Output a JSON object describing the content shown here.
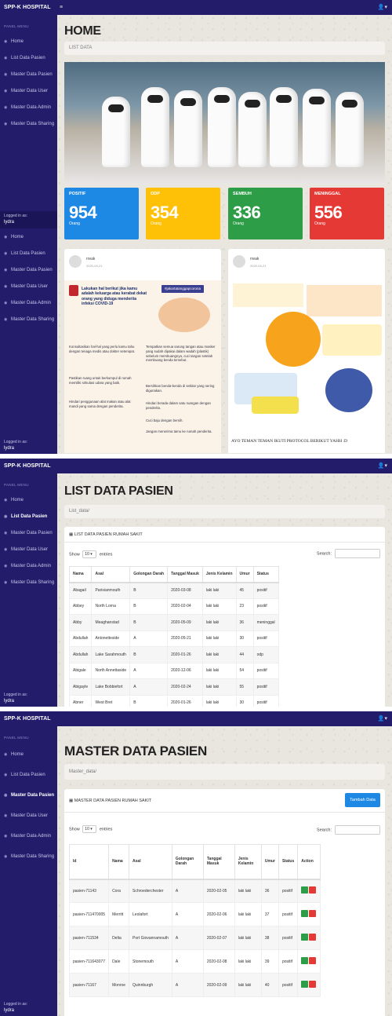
{
  "app": {
    "brand": "SPP-K HOSPITAL",
    "user_icon": "user-icon"
  },
  "sidebar": {
    "menu_header": "PANEL MENU",
    "items": [
      "Home",
      "List Data Pasien",
      "Master Data Pasien",
      "Master Data User",
      "Master Data Admin",
      "Master Data Sharing"
    ],
    "logged_label": "Logged in as:",
    "logged_user": "lydra"
  },
  "home": {
    "title": "HOME",
    "breadcrumb": "LIST DATA",
    "stats": [
      {
        "label": "POSITIF",
        "value": "954",
        "unit": "Orang",
        "color": "#1e88e5"
      },
      {
        "label": "ODP",
        "value": "354",
        "unit": "Orang",
        "color": "#ffc107"
      },
      {
        "label": "SEMBUH",
        "value": "336",
        "unit": "Orang",
        "color": "#2e9d48"
      },
      {
        "label": "MENINGGAL",
        "value": "556",
        "unit": "Orang",
        "color": "#e53935"
      }
    ],
    "posts": [
      {
        "name": "rreak",
        "date": "2020-04-21",
        "hashtag": "#jakartatanggapcorona",
        "intro": "Lakukan hal berikut jika kamu adalah keluarga atau kerabat dekat orang yang diduga menderita infeksi COVID-19",
        "steps": [
          "Konsultasikan hal-hal yang perlu kamu tahu dengan tenaga medis atau dokter setempat.",
          "Pastikan ruang untuk berkumpul di rumah memiliki sirkulasi udara yang baik.",
          "Hindari penggunaan alat makan atau alat mandi yang sama dengan penderita.",
          "Tempatkan semua sarung tangan atau masker yang sudah dipakai dalam wadah (plastik) sebelum membuangnya, cuci tangan setelah membuang benda tersebut.",
          "Bersihkan benda-benda di sekitar yang sering digunakan.",
          "Hindari berada dalam satu ruangan dengan penderita.",
          "Cuci baju dengan bersih.",
          "Jangan menerima tamu ke rumah penderita."
        ]
      },
      {
        "name": "rreak",
        "date": "2020-04-21",
        "caption": "AYO TEMAN TEMAN IKUTI PROTOCOL BERIKUT YAHH :D"
      }
    ]
  },
  "list": {
    "title": "LIST DATA PASIEN",
    "breadcrumb": "List_data/",
    "card_title": "LIST DATA PASIEN RUMAH SAKIT",
    "show": "Show",
    "entries": "entries",
    "entries_value": "10",
    "search": "Search:",
    "columns": [
      "Nama",
      "Asal",
      "Golongan Darah",
      "Tanggal Masuk",
      "Jenis Kelamin",
      "Umur",
      "Status"
    ],
    "rows": [
      [
        "Abagail",
        "Parisianmouth",
        "B",
        "2020-03-08",
        "laki laki",
        "45",
        "positif"
      ],
      [
        "Abbey",
        "North Lorna",
        "B",
        "2020-02-04",
        "laki laki",
        "23",
        "positif"
      ],
      [
        "Abby",
        "Meaghanstad",
        "B",
        "2020-05-09",
        "laki laki",
        "36",
        "meninggal"
      ],
      [
        "Abdullah",
        "Antonetteside",
        "A",
        "2020-05-21",
        "laki laki",
        "30",
        "positif"
      ],
      [
        "Abdullah",
        "Lake Sarahmouth",
        "B",
        "2020-01-26",
        "laki laki",
        "44",
        "odp"
      ],
      [
        "Abigale",
        "North Annettaside",
        "A",
        "2020-12-06",
        "laki laki",
        "54",
        "positif"
      ],
      [
        "Abigayle",
        "Lake Bobbiefort",
        "A",
        "2020-02-24",
        "laki laki",
        "55",
        "positif"
      ],
      [
        "Abner",
        "West Bret",
        "B",
        "2020-01-26",
        "laki laki",
        "30",
        "positif"
      ]
    ]
  },
  "master": {
    "title": "MASTER DATA PASIEN",
    "breadcrumb": "Master_data/",
    "card_title": "MASTER DATA PASIEN RUMAH SAKIT",
    "add_button": "Tambah Data",
    "show": "Show",
    "entries": "entries",
    "entries_value": "10",
    "search": "Search:",
    "columns": [
      "Id",
      "Nama",
      "Asal",
      "Golongan Darah",
      "Tanggal Masuk",
      "Jenis Kelamin",
      "Umur",
      "Status",
      "Action"
    ],
    "rows": [
      [
        "pasien-71143",
        "Cora",
        "Schroederchester",
        "A",
        "2020-02-05",
        "laki laki",
        "36",
        "positif"
      ],
      [
        "pasien-711470005",
        "Merritt",
        "Leolafort",
        "A",
        "2020-02-06",
        "laki laki",
        "37",
        "positif"
      ],
      [
        "pasien-711534",
        "Delta",
        "Port Giovannamouth",
        "A",
        "2020-02-07",
        "laki laki",
        "38",
        "positif"
      ],
      [
        "pasien-711643077",
        "Dale",
        "Stonemouth",
        "A",
        "2020-02-08",
        "laki laki",
        "39",
        "positif"
      ],
      [
        "pasien-71167",
        "Monroe",
        "Quinnburgh",
        "A",
        "2020-02-09",
        "laki laki",
        "40",
        "positif"
      ]
    ]
  }
}
